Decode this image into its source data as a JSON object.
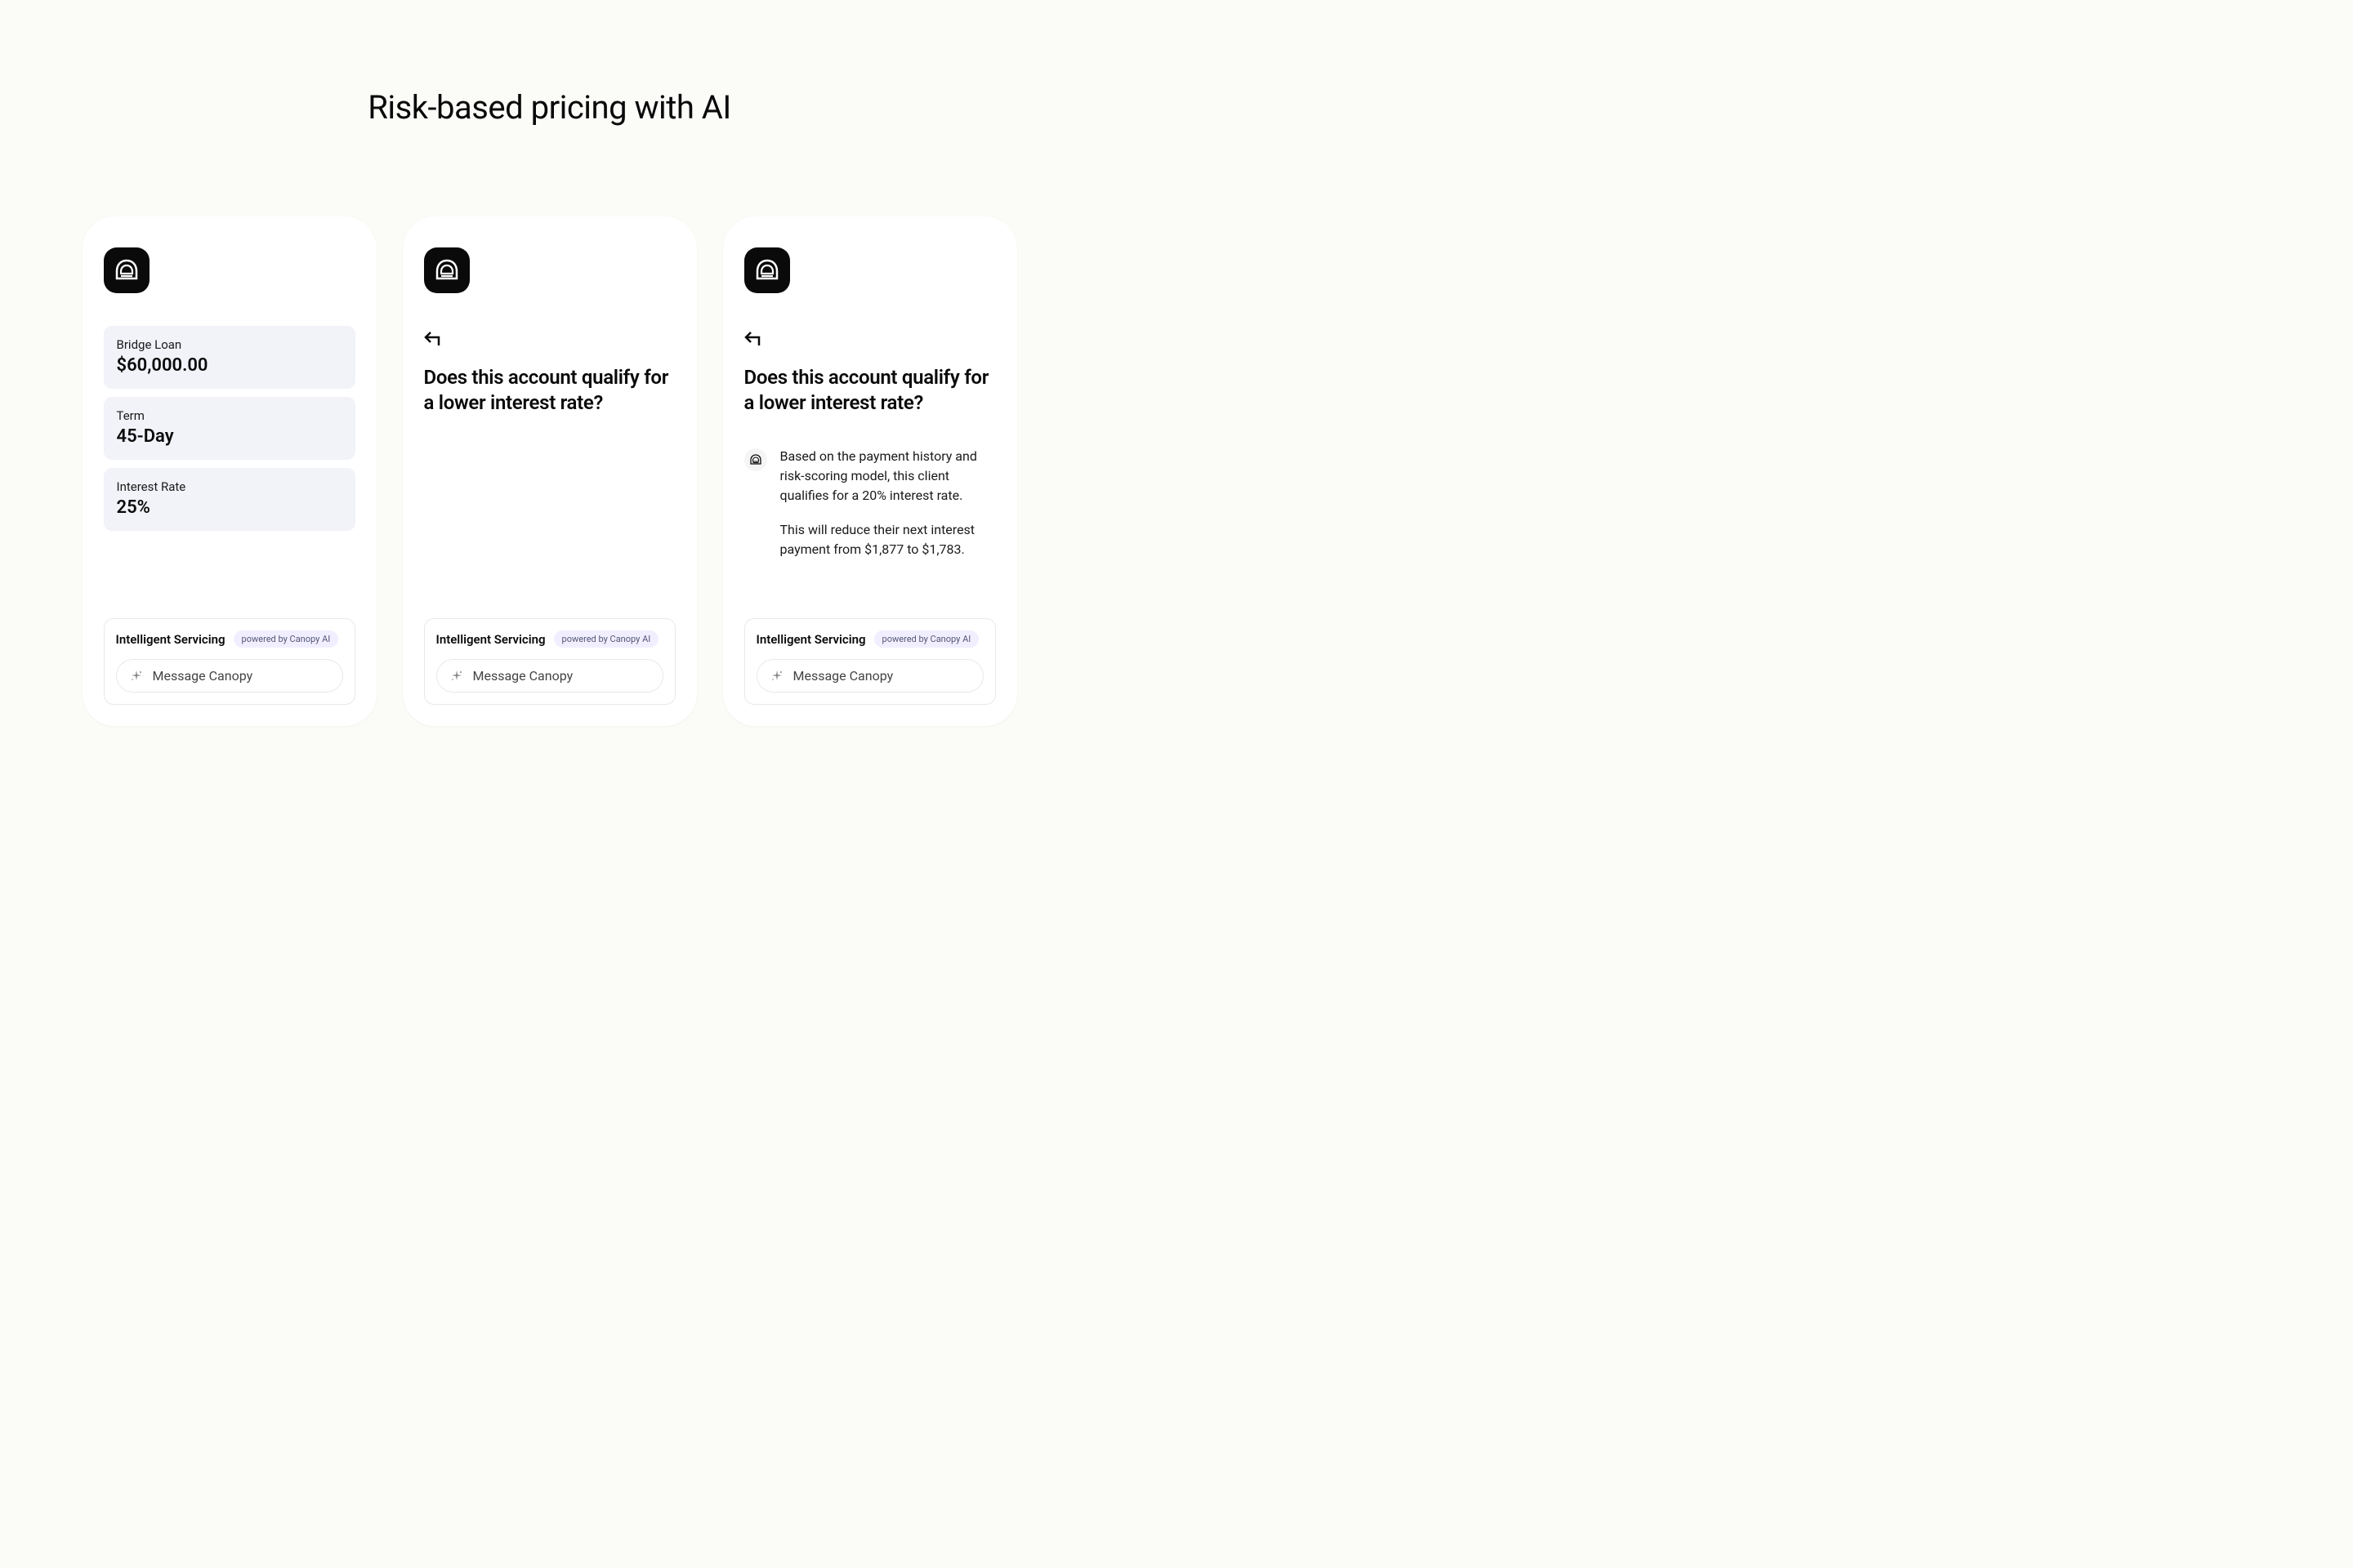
{
  "page": {
    "title": "Risk-based pricing with AI"
  },
  "cards": {
    "card1": {
      "loan": {
        "label": "Bridge Loan",
        "value": "$60,000.00"
      },
      "term": {
        "label": "Term",
        "value": "45-Day"
      },
      "rate": {
        "label": "Interest Rate",
        "value": "25%"
      }
    },
    "card2": {
      "question": "Does this account qualify for a lower interest rate?"
    },
    "card3": {
      "question": "Does this account qualify for a lower interest rate?",
      "response": {
        "p1": "Based on the payment history and risk-scoring model, this client qualifies for a 20% interest rate.",
        "p2": "This will reduce their next interest payment from $1,877 to $1,783."
      }
    }
  },
  "servicing": {
    "title": "Intelligent Servicing",
    "badge": "powered by Canopy AI",
    "placeholder": "Message Canopy"
  }
}
